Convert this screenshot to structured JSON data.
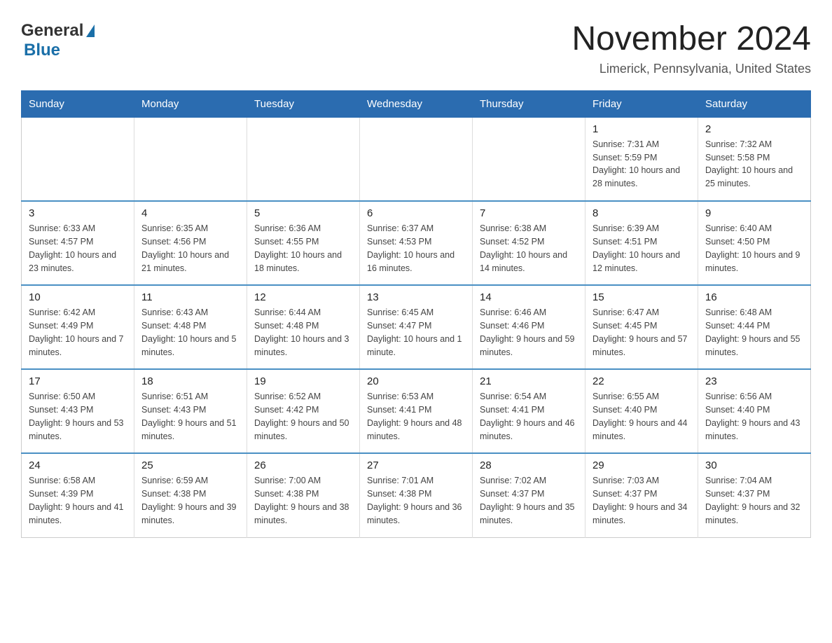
{
  "header": {
    "logo_general": "General",
    "logo_blue": "Blue",
    "main_title": "November 2024",
    "subtitle": "Limerick, Pennsylvania, United States"
  },
  "days_of_week": [
    "Sunday",
    "Monday",
    "Tuesday",
    "Wednesday",
    "Thursday",
    "Friday",
    "Saturday"
  ],
  "weeks": [
    {
      "days": [
        {
          "number": "",
          "sunrise": "",
          "sunset": "",
          "daylight": ""
        },
        {
          "number": "",
          "sunrise": "",
          "sunset": "",
          "daylight": ""
        },
        {
          "number": "",
          "sunrise": "",
          "sunset": "",
          "daylight": ""
        },
        {
          "number": "",
          "sunrise": "",
          "sunset": "",
          "daylight": ""
        },
        {
          "number": "",
          "sunrise": "",
          "sunset": "",
          "daylight": ""
        },
        {
          "number": "1",
          "sunrise": "Sunrise: 7:31 AM",
          "sunset": "Sunset: 5:59 PM",
          "daylight": "Daylight: 10 hours and 28 minutes."
        },
        {
          "number": "2",
          "sunrise": "Sunrise: 7:32 AM",
          "sunset": "Sunset: 5:58 PM",
          "daylight": "Daylight: 10 hours and 25 minutes."
        }
      ]
    },
    {
      "days": [
        {
          "number": "3",
          "sunrise": "Sunrise: 6:33 AM",
          "sunset": "Sunset: 4:57 PM",
          "daylight": "Daylight: 10 hours and 23 minutes."
        },
        {
          "number": "4",
          "sunrise": "Sunrise: 6:35 AM",
          "sunset": "Sunset: 4:56 PM",
          "daylight": "Daylight: 10 hours and 21 minutes."
        },
        {
          "number": "5",
          "sunrise": "Sunrise: 6:36 AM",
          "sunset": "Sunset: 4:55 PM",
          "daylight": "Daylight: 10 hours and 18 minutes."
        },
        {
          "number": "6",
          "sunrise": "Sunrise: 6:37 AM",
          "sunset": "Sunset: 4:53 PM",
          "daylight": "Daylight: 10 hours and 16 minutes."
        },
        {
          "number": "7",
          "sunrise": "Sunrise: 6:38 AM",
          "sunset": "Sunset: 4:52 PM",
          "daylight": "Daylight: 10 hours and 14 minutes."
        },
        {
          "number": "8",
          "sunrise": "Sunrise: 6:39 AM",
          "sunset": "Sunset: 4:51 PM",
          "daylight": "Daylight: 10 hours and 12 minutes."
        },
        {
          "number": "9",
          "sunrise": "Sunrise: 6:40 AM",
          "sunset": "Sunset: 4:50 PM",
          "daylight": "Daylight: 10 hours and 9 minutes."
        }
      ]
    },
    {
      "days": [
        {
          "number": "10",
          "sunrise": "Sunrise: 6:42 AM",
          "sunset": "Sunset: 4:49 PM",
          "daylight": "Daylight: 10 hours and 7 minutes."
        },
        {
          "number": "11",
          "sunrise": "Sunrise: 6:43 AM",
          "sunset": "Sunset: 4:48 PM",
          "daylight": "Daylight: 10 hours and 5 minutes."
        },
        {
          "number": "12",
          "sunrise": "Sunrise: 6:44 AM",
          "sunset": "Sunset: 4:48 PM",
          "daylight": "Daylight: 10 hours and 3 minutes."
        },
        {
          "number": "13",
          "sunrise": "Sunrise: 6:45 AM",
          "sunset": "Sunset: 4:47 PM",
          "daylight": "Daylight: 10 hours and 1 minute."
        },
        {
          "number": "14",
          "sunrise": "Sunrise: 6:46 AM",
          "sunset": "Sunset: 4:46 PM",
          "daylight": "Daylight: 9 hours and 59 minutes."
        },
        {
          "number": "15",
          "sunrise": "Sunrise: 6:47 AM",
          "sunset": "Sunset: 4:45 PM",
          "daylight": "Daylight: 9 hours and 57 minutes."
        },
        {
          "number": "16",
          "sunrise": "Sunrise: 6:48 AM",
          "sunset": "Sunset: 4:44 PM",
          "daylight": "Daylight: 9 hours and 55 minutes."
        }
      ]
    },
    {
      "days": [
        {
          "number": "17",
          "sunrise": "Sunrise: 6:50 AM",
          "sunset": "Sunset: 4:43 PM",
          "daylight": "Daylight: 9 hours and 53 minutes."
        },
        {
          "number": "18",
          "sunrise": "Sunrise: 6:51 AM",
          "sunset": "Sunset: 4:43 PM",
          "daylight": "Daylight: 9 hours and 51 minutes."
        },
        {
          "number": "19",
          "sunrise": "Sunrise: 6:52 AM",
          "sunset": "Sunset: 4:42 PM",
          "daylight": "Daylight: 9 hours and 50 minutes."
        },
        {
          "number": "20",
          "sunrise": "Sunrise: 6:53 AM",
          "sunset": "Sunset: 4:41 PM",
          "daylight": "Daylight: 9 hours and 48 minutes."
        },
        {
          "number": "21",
          "sunrise": "Sunrise: 6:54 AM",
          "sunset": "Sunset: 4:41 PM",
          "daylight": "Daylight: 9 hours and 46 minutes."
        },
        {
          "number": "22",
          "sunrise": "Sunrise: 6:55 AM",
          "sunset": "Sunset: 4:40 PM",
          "daylight": "Daylight: 9 hours and 44 minutes."
        },
        {
          "number": "23",
          "sunrise": "Sunrise: 6:56 AM",
          "sunset": "Sunset: 4:40 PM",
          "daylight": "Daylight: 9 hours and 43 minutes."
        }
      ]
    },
    {
      "days": [
        {
          "number": "24",
          "sunrise": "Sunrise: 6:58 AM",
          "sunset": "Sunset: 4:39 PM",
          "daylight": "Daylight: 9 hours and 41 minutes."
        },
        {
          "number": "25",
          "sunrise": "Sunrise: 6:59 AM",
          "sunset": "Sunset: 4:38 PM",
          "daylight": "Daylight: 9 hours and 39 minutes."
        },
        {
          "number": "26",
          "sunrise": "Sunrise: 7:00 AM",
          "sunset": "Sunset: 4:38 PM",
          "daylight": "Daylight: 9 hours and 38 minutes."
        },
        {
          "number": "27",
          "sunrise": "Sunrise: 7:01 AM",
          "sunset": "Sunset: 4:38 PM",
          "daylight": "Daylight: 9 hours and 36 minutes."
        },
        {
          "number": "28",
          "sunrise": "Sunrise: 7:02 AM",
          "sunset": "Sunset: 4:37 PM",
          "daylight": "Daylight: 9 hours and 35 minutes."
        },
        {
          "number": "29",
          "sunrise": "Sunrise: 7:03 AM",
          "sunset": "Sunset: 4:37 PM",
          "daylight": "Daylight: 9 hours and 34 minutes."
        },
        {
          "number": "30",
          "sunrise": "Sunrise: 7:04 AM",
          "sunset": "Sunset: 4:37 PM",
          "daylight": "Daylight: 9 hours and 32 minutes."
        }
      ]
    }
  ]
}
